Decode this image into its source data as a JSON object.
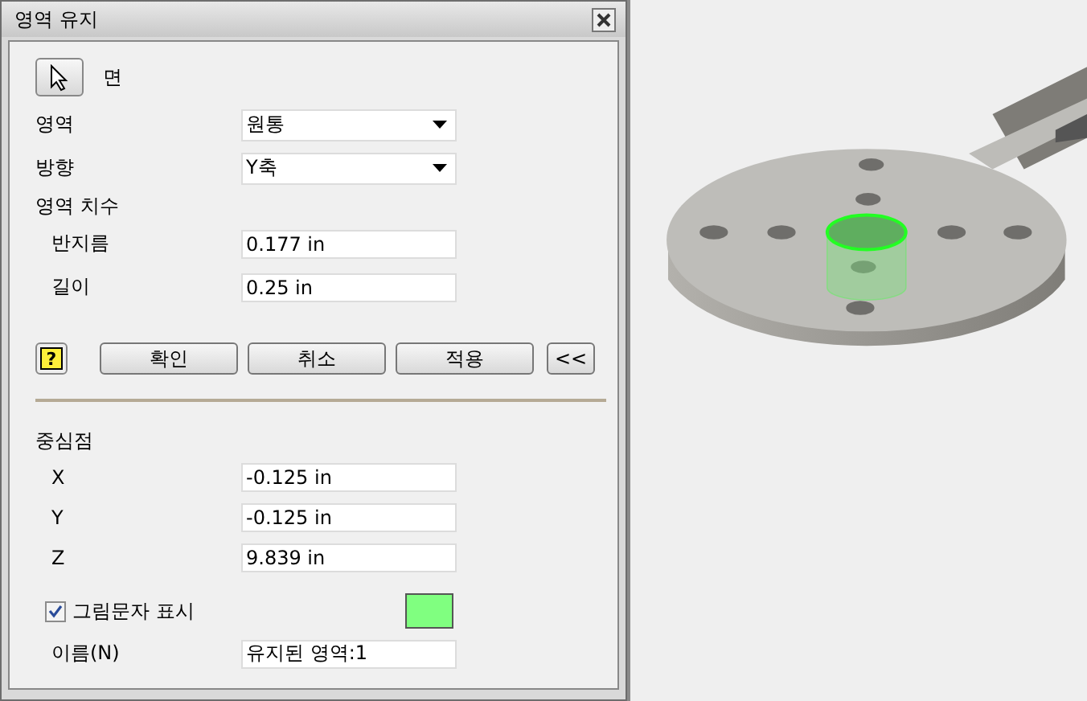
{
  "window": {
    "title": "영역 유지"
  },
  "selector": {
    "label": "면"
  },
  "rows": [
    {
      "kind": "dropdown",
      "label": "영역",
      "value": "원통"
    },
    {
      "kind": "dropdown",
      "label": "방향",
      "value": "Y축"
    },
    {
      "kind": "heading",
      "label": "영역 치수"
    },
    {
      "kind": "input",
      "label": "반지름",
      "value": "0.177 in"
    },
    {
      "kind": "input",
      "label": "길이",
      "value": "0.25 in"
    }
  ],
  "help_button": "?",
  "buttons": [
    "확인",
    "취소",
    "적용"
  ],
  "toggle_button": "<<",
  "center": {
    "title": "중심점",
    "rows": [
      {
        "label": "X",
        "value": "-0.125 in"
      },
      {
        "label": "Y",
        "value": "-0.125 in"
      },
      {
        "label": "Z",
        "value": "9.839 in"
      }
    ]
  },
  "glyph": {
    "label": "그림문자 표시",
    "checked": true,
    "color": "#80ff80"
  },
  "name": {
    "label": "이름(N)",
    "value": "유지된 영역:1"
  }
}
